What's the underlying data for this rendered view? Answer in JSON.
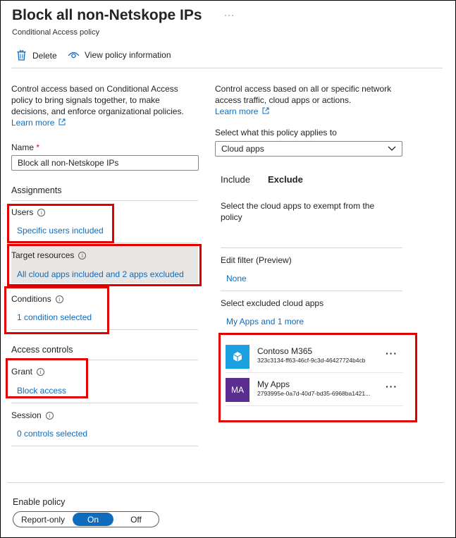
{
  "header": {
    "title": "Block all non-Netskope IPs",
    "more": "···",
    "subtitle": "Conditional Access policy"
  },
  "toolbar": {
    "delete_label": "Delete",
    "view_label": "View policy information"
  },
  "left": {
    "intro_lines": [
      "Control access based on Conditional Access",
      "policy to bring signals together, to make",
      "decisions, and enforce organizational policies."
    ],
    "learn_more": "Learn more",
    "name_label": "Name",
    "name_required": "*",
    "name_value": "Block all non-Netskope IPs",
    "assignments_heading": "Assignments",
    "users_label": "Users",
    "users_value": "Specific users included",
    "target_label": "Target resources",
    "target_value": "All cloud apps included and 2 apps excluded",
    "conditions_label": "Conditions",
    "conditions_value": "1 condition selected",
    "access_heading": "Access controls",
    "grant_label": "Grant",
    "grant_value": "Block access",
    "session_label": "Session",
    "session_value": "0 controls selected"
  },
  "right": {
    "intro_lines": [
      "Control access based on all or specific network",
      "access traffic, cloud apps or actions."
    ],
    "learn_more": "Learn more",
    "applies_label": "Select what this policy applies to",
    "applies_value": "Cloud apps",
    "tabs": {
      "include": "Include",
      "exclude": "Exclude"
    },
    "exempt_lines": [
      "Select the cloud apps to exempt from the",
      "policy"
    ],
    "filter_label": "Edit filter (Preview)",
    "filter_value": "None",
    "excluded_label": "Select excluded cloud apps",
    "excluded_value": "My Apps and 1 more",
    "apps": [
      {
        "name": "Contoso M365",
        "id": "323c3134-ff63-46cf-9c3d-46427724b4cb",
        "icon": "cube-icon",
        "color": "#1ba1e2",
        "more": "···"
      },
      {
        "name": "My Apps",
        "id": "2793995e-0a7d-40d7-bd35-6968ba1421...",
        "initials": "MA",
        "color": "#5c2d91",
        "more": "···"
      }
    ]
  },
  "footer": {
    "enable_label": "Enable policy",
    "options": [
      "Report-only",
      "On",
      "Off"
    ]
  },
  "colors": {
    "accent": "#0f6cbd",
    "highlight": "#e00000",
    "selected_bg": "#e8e6e4"
  }
}
